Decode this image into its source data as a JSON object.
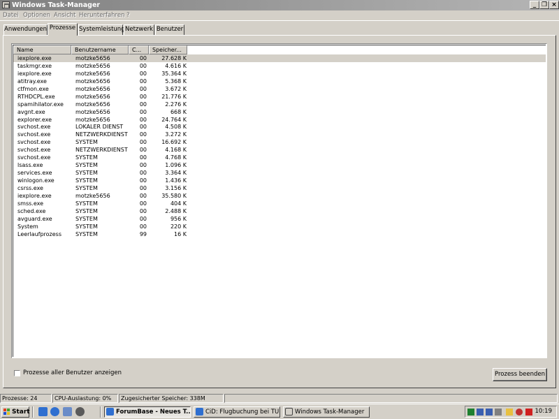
{
  "window": {
    "title": "Windows Task-Manager"
  },
  "menu": [
    "Datei",
    "Optionen",
    "Ansicht",
    "Herunterfahren",
    "?"
  ],
  "tabs": [
    "Anwendungen",
    "Prozesse",
    "Systemleistung",
    "Netzwerk",
    "Benutzer"
  ],
  "active_tab": "Prozesse",
  "columns": [
    "Name",
    "Benutzername",
    "C...",
    "Speicher..."
  ],
  "processes": [
    {
      "name": "iexplore.exe",
      "user": "motzke5656",
      "cpu": "00",
      "mem": "27.628 K",
      "selected": true
    },
    {
      "name": "taskmgr.exe",
      "user": "motzke5656",
      "cpu": "00",
      "mem": "4.616 K"
    },
    {
      "name": "iexplore.exe",
      "user": "motzke5656",
      "cpu": "00",
      "mem": "35.364 K"
    },
    {
      "name": "atitray.exe",
      "user": "motzke5656",
      "cpu": "00",
      "mem": "5.368 K"
    },
    {
      "name": "ctfmon.exe",
      "user": "motzke5656",
      "cpu": "00",
      "mem": "3.672 K"
    },
    {
      "name": "RTHDCPL.exe",
      "user": "motzke5656",
      "cpu": "00",
      "mem": "21.776 K"
    },
    {
      "name": "spamihilator.exe",
      "user": "motzke5656",
      "cpu": "00",
      "mem": "2.276 K"
    },
    {
      "name": "avgnt.exe",
      "user": "motzke5656",
      "cpu": "00",
      "mem": "668 K"
    },
    {
      "name": "explorer.exe",
      "user": "motzke5656",
      "cpu": "00",
      "mem": "24.764 K"
    },
    {
      "name": "svchost.exe",
      "user": "LOKALER DIENST",
      "cpu": "00",
      "mem": "4.508 K"
    },
    {
      "name": "svchost.exe",
      "user": "NETZWERKDIENST",
      "cpu": "00",
      "mem": "3.272 K"
    },
    {
      "name": "svchost.exe",
      "user": "SYSTEM",
      "cpu": "00",
      "mem": "16.692 K"
    },
    {
      "name": "svchost.exe",
      "user": "NETZWERKDIENST",
      "cpu": "00",
      "mem": "4.168 K"
    },
    {
      "name": "svchost.exe",
      "user": "SYSTEM",
      "cpu": "00",
      "mem": "4.768 K"
    },
    {
      "name": "lsass.exe",
      "user": "SYSTEM",
      "cpu": "00",
      "mem": "1.096 K"
    },
    {
      "name": "services.exe",
      "user": "SYSTEM",
      "cpu": "00",
      "mem": "3.364 K"
    },
    {
      "name": "winlogon.exe",
      "user": "SYSTEM",
      "cpu": "00",
      "mem": "1.436 K"
    },
    {
      "name": "csrss.exe",
      "user": "SYSTEM",
      "cpu": "00",
      "mem": "3.156 K"
    },
    {
      "name": "iexplore.exe",
      "user": "motzke5656",
      "cpu": "00",
      "mem": "35.580 K"
    },
    {
      "name": "smss.exe",
      "user": "SYSTEM",
      "cpu": "00",
      "mem": "404 K"
    },
    {
      "name": "sched.exe",
      "user": "SYSTEM",
      "cpu": "00",
      "mem": "2.488 K"
    },
    {
      "name": "avguard.exe",
      "user": "SYSTEM",
      "cpu": "00",
      "mem": "956 K"
    },
    {
      "name": "System",
      "user": "SYSTEM",
      "cpu": "00",
      "mem": "220 K"
    },
    {
      "name": "Leerlaufprozess",
      "user": "SYSTEM",
      "cpu": "99",
      "mem": "16 K"
    }
  ],
  "checkbox_label": "Prozesse aller Benutzer anzeigen",
  "checkbox_checked": false,
  "end_process_button": "Prozess beenden",
  "status": {
    "processes": "Prozesse: 24",
    "cpu": "CPU-Auslastung: 0%",
    "commit": "Zugesicherter Speicher: 338M"
  },
  "taskbar": {
    "start": "Start",
    "quicklaunch_icons": [
      "ie-icon",
      "ie-icon",
      "outlook-icon",
      "media-player-icon"
    ],
    "tasks": [
      {
        "label": "ForumBase - Neues T...",
        "active": true
      },
      {
        "label": "CiD: Flugbuchung bei TU...",
        "active": false
      },
      {
        "label": "Windows Task-Manager",
        "active": false
      }
    ],
    "tray_icons": [
      "green-icon",
      "network-icon",
      "network-icon",
      "shield-icon",
      "mail-icon",
      "bug-icon",
      "antivir-icon"
    ],
    "clock": "10:19"
  },
  "colors": {
    "face": "#d4d0c8",
    "title_inactive_left": "#808080",
    "title_inactive_right": "#b5b5b5",
    "list_bg": "#ffffff"
  }
}
